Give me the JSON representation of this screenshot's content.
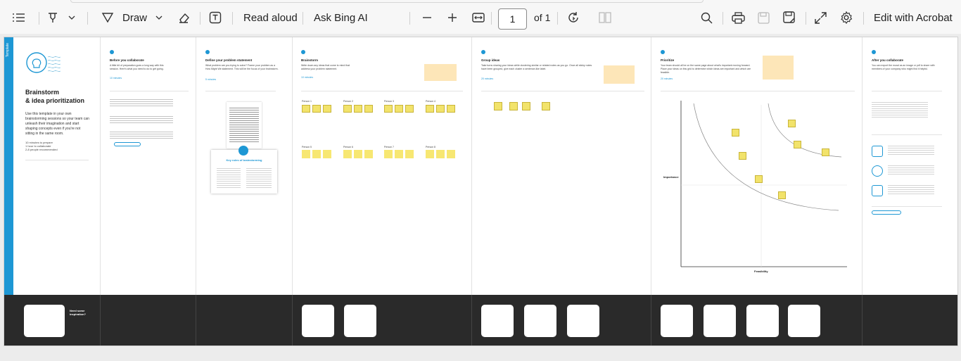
{
  "toolbar": {
    "draw_label": "Draw",
    "read_aloud_label": "Read aloud",
    "ask_bing_label": "Ask Bing AI",
    "page_current": "1",
    "page_total": "of 1",
    "edit_acrobat_label": "Edit with Acrobat",
    "icons": [
      "contents-icon",
      "highlight-icon",
      "chevron-down-icon",
      "draw-icon",
      "chevron-down-icon",
      "eraser-icon",
      "text-box-icon",
      "zoom-out-icon",
      "zoom-in-icon",
      "fit-page-icon",
      "rotate-icon",
      "page-view-icon",
      "search-icon",
      "print-icon",
      "save-icon",
      "save-as-icon",
      "fullscreen-icon",
      "settings-icon"
    ]
  },
  "doc": {
    "strip_label": "Template",
    "left": {
      "title_line1": "Brainstorm",
      "title_line2": "& idea prioritization",
      "desc": "Use this template in your own brainstorming sessions so your team can unleash their imagination and start shaping concepts even if you're not sitting in the same room.",
      "meta": [
        "10 minutes to prepare",
        "1 hour to collaborate",
        "2-8 people recommended"
      ]
    },
    "sections": [
      {
        "title": "Before you collaborate",
        "sub": "A little bit of preparation goes a long way with this session. Here's what you need to do to get going.",
        "time": "10 minutes"
      },
      {
        "title": "Define your problem statement",
        "sub": "What problem are you trying to solve? Frame your problem as a How Might We statement. This will be the focus of your brainstorm.",
        "time": "5 minutes"
      },
      {
        "title": "Brainstorm",
        "sub": "Write down any ideas that come to mind that address your problem statement.",
        "time": "10 minutes"
      },
      {
        "title": "Group ideas",
        "sub": "Take turns sharing your ideas while clustering similar or related notes as you go. Once all sticky notes have been grouped, give each cluster a sentence-like label.",
        "time": "20 minutes"
      },
      {
        "title": "Prioritize",
        "sub": "Your team should all be on the same page about what's important moving forward. Place your ideas on this grid to determine which ideas are important and which are feasible.",
        "time": "20 minutes"
      },
      {
        "title": "After you collaborate",
        "sub": "You can export the mural as an image or pdf to share with members of your company who might find it helpful."
      }
    ],
    "problem_card_title": "Key rules of brainstorming",
    "person_labels": [
      "Person 1",
      "Person 2",
      "Person 3",
      "Person 4",
      "Person 5",
      "Person 6",
      "Person 7",
      "Person 8"
    ],
    "prioritize_axis_x": "Feasibility",
    "prioritize_axis_y": "Importance",
    "band_text": "Need some inspiration?"
  }
}
